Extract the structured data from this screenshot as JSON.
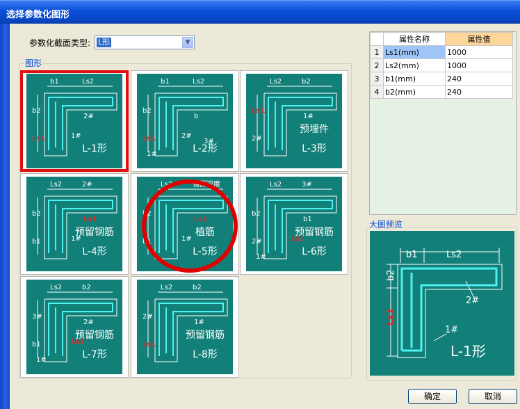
{
  "window": {
    "title": "选择参数化图形"
  },
  "section_type": {
    "label": "参数化截面类型:",
    "selected": "L形"
  },
  "shapes_group": {
    "label": "图形"
  },
  "shapes": [
    {
      "id": "L-1",
      "name": "L-1形",
      "caption": "",
      "selected": true,
      "dims": [
        "b1",
        "Ls2",
        "b2",
        "Ls1",
        "2#",
        "1#"
      ]
    },
    {
      "id": "L-2",
      "name": "L-2形",
      "caption": "",
      "selected": false,
      "dims": [
        "b1",
        "Ls2",
        "b2",
        "Ls1",
        "b",
        "2#",
        "1#",
        "3#"
      ]
    },
    {
      "id": "L-3",
      "name": "L-3形",
      "caption": "预埋件",
      "selected": false,
      "dims": [
        "Ls2",
        "b2",
        "Ls1",
        "2#",
        "1#"
      ]
    },
    {
      "id": "L-4",
      "name": "L-4形",
      "caption": "预留钢筋",
      "selected": false,
      "dims": [
        "Ls2",
        "2#",
        "b2",
        "b1",
        "Ls1",
        "1#"
      ]
    },
    {
      "id": "L-5",
      "name": "L-5形",
      "caption": "植筋",
      "selected": false,
      "dims": [
        "Ls2",
        "锚固深度",
        "b2",
        "b1",
        "Ls1",
        "1#"
      ]
    },
    {
      "id": "L-6",
      "name": "L-6形",
      "caption": "预留钢筋",
      "selected": false,
      "dims": [
        "Ls2",
        "3#",
        "b2",
        "2#",
        "b1",
        "Ls1",
        "1#"
      ]
    },
    {
      "id": "L-7",
      "name": "L-7形",
      "caption": "预留钢筋",
      "selected": false,
      "dims": [
        "Ls2",
        "b2",
        "3#",
        "b1",
        "2#",
        "Ls1",
        "1#"
      ]
    },
    {
      "id": "L-8",
      "name": "L-8形",
      "caption": "预留钢筋",
      "selected": false,
      "dims": [
        "Ls2",
        "b2",
        "2#",
        "Ls1",
        "1#"
      ]
    }
  ],
  "properties": {
    "col_name": "属性名称",
    "col_value": "属性值",
    "rows": [
      {
        "num": "1",
        "name": "Ls1(mm)",
        "value": "1000"
      },
      {
        "num": "2",
        "name": "Ls2(mm)",
        "value": "1000"
      },
      {
        "num": "3",
        "name": "b1(mm)",
        "value": "240"
      },
      {
        "num": "4",
        "name": "b2(mm)",
        "value": "240"
      }
    ]
  },
  "preview": {
    "label": "大图预览",
    "name": "L-1形",
    "dims": [
      "b1",
      "Ls2",
      "b2",
      "Ls1",
      "2#",
      "1#"
    ]
  },
  "buttons": {
    "ok": "确定",
    "cancel": "取消"
  },
  "colors": {
    "teal": "#128078",
    "cyan": "#4ff0f0",
    "dim_label_red": "#d83030",
    "highlight_red": "#e00000"
  }
}
